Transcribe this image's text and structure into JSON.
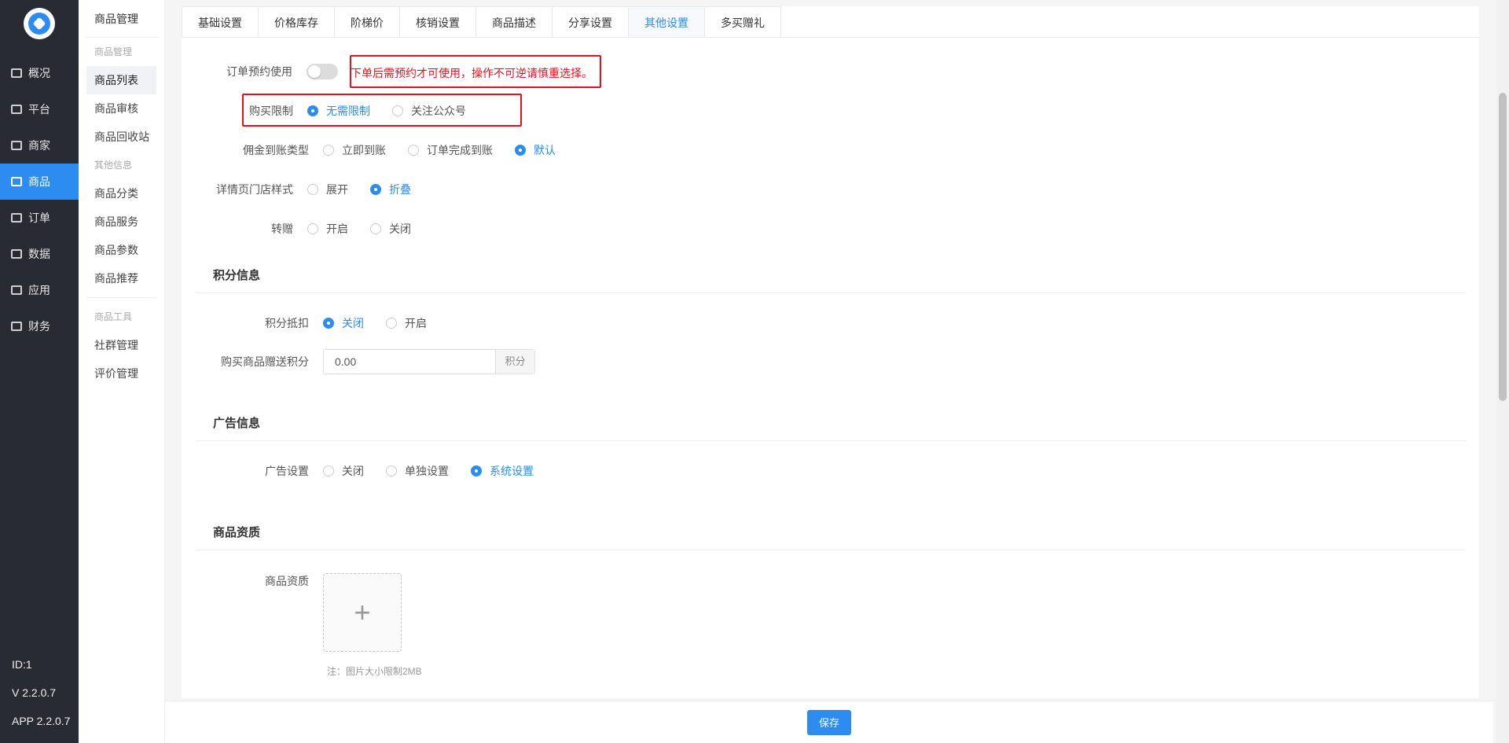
{
  "nav": {
    "items": [
      {
        "label": "概况",
        "icon": "monitor-icon"
      },
      {
        "label": "平台",
        "icon": "desktop-icon"
      },
      {
        "label": "商家",
        "icon": "store-icon"
      },
      {
        "label": "商品",
        "icon": "goods-icon",
        "active": true
      },
      {
        "label": "订单",
        "icon": "order-icon"
      },
      {
        "label": "数据",
        "icon": "chart-icon"
      },
      {
        "label": "应用",
        "icon": "apps-icon"
      },
      {
        "label": "财务",
        "icon": "finance-icon"
      }
    ],
    "footer": {
      "id": "ID:1",
      "version": "V 2.2.0.7",
      "app_version": "APP 2.2.0.7"
    }
  },
  "submenu": {
    "title": "商品管理",
    "group1": "商品管理",
    "items1": [
      "商品列表",
      "商品审核",
      "商品回收站"
    ],
    "group2": "其他信息",
    "items2": [
      "商品分类",
      "商品服务",
      "商品参数",
      "商品推荐"
    ],
    "group3": "商品工具",
    "items3": [
      "社群管理",
      "评价管理"
    ]
  },
  "tabs": [
    "基础设置",
    "价格库存",
    "阶梯价",
    "核销设置",
    "商品描述",
    "分享设置",
    "其他设置",
    "多买赠礼"
  ],
  "form": {
    "reserve": {
      "label": "订单预约使用",
      "warning": "下单后需预约才可使用，操作不可逆请慎重选择。"
    },
    "purchase_limit": {
      "label": "购买限制",
      "opt1": "无需限制",
      "opt2": "关注公众号"
    },
    "commission": {
      "label": "佣金到账类型",
      "opt1": "立即到账",
      "opt2": "订单完成到账",
      "opt3": "默认"
    },
    "store_style": {
      "label": "详情页门店样式",
      "opt1": "展开",
      "opt2": "折叠"
    },
    "gift": {
      "label": "转赠",
      "opt1": "开启",
      "opt2": "关闭"
    }
  },
  "points": {
    "title": "积分信息",
    "deduct": {
      "label": "积分抵扣",
      "opt1": "关闭",
      "opt2": "开启"
    },
    "bonus": {
      "label": "购买商品赠送积分",
      "value": "0.00",
      "unit": "积分"
    }
  },
  "ads": {
    "title": "广告信息",
    "setting": {
      "label": "广告设置",
      "opt1": "关闭",
      "opt2": "单独设置",
      "opt3": "系统设置"
    }
  },
  "qualification": {
    "title": "商品资质",
    "label": "商品资质",
    "upload_icon": "+",
    "note": "注：图片大小限制2MB"
  },
  "save_label": "保存"
}
